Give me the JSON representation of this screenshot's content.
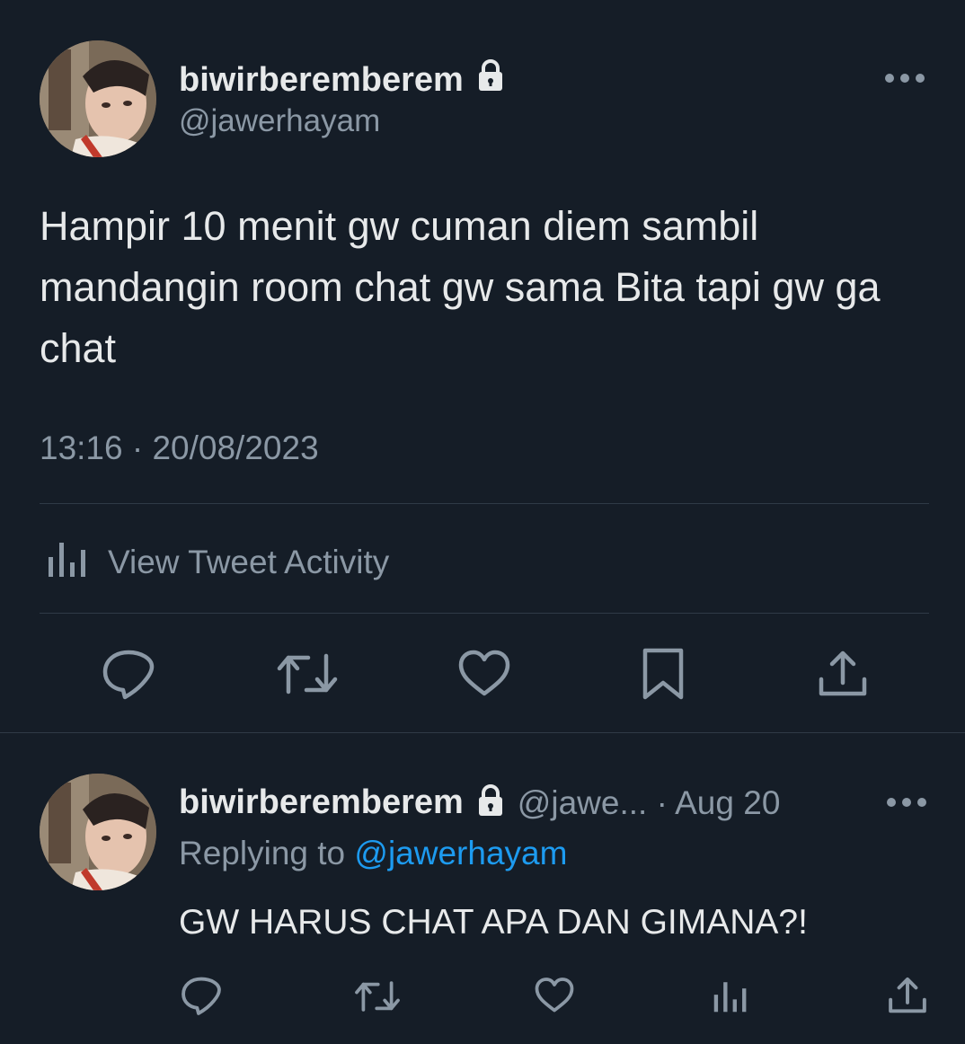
{
  "colors": {
    "background": "#151d27",
    "text": "#e7e9ea",
    "muted": "#8b98a5",
    "link": "#1d9bf0",
    "divider": "#2f3a47"
  },
  "main_tweet": {
    "display_name": "biwirberemberem",
    "lock_icon": "lock-icon",
    "handle": "@jawerhayam",
    "more_icon": "more-horizontal-icon",
    "text": "Hampir 10 menit gw cuman diem sambil mandangin room chat gw sama Bita tapi gw ga chat",
    "timestamp": "13:16 · 20/08/2023",
    "activity_label": "View Tweet Activity",
    "actions": [
      "reply-icon",
      "retweet-icon",
      "like-icon",
      "bookmark-icon",
      "share-icon"
    ]
  },
  "reply_tweet": {
    "display_name": "biwirberemberem",
    "lock_icon": "lock-icon",
    "handle_and_date": "@jawe... · Aug 20",
    "replying_to_prefix": "Replying to ",
    "replying_to_handle": "@jawerhayam",
    "text": "GW HARUS CHAT APA DAN GIMANA?!",
    "actions": [
      "reply-icon",
      "retweet-icon",
      "like-icon",
      "analytics-icon",
      "share-icon"
    ]
  }
}
